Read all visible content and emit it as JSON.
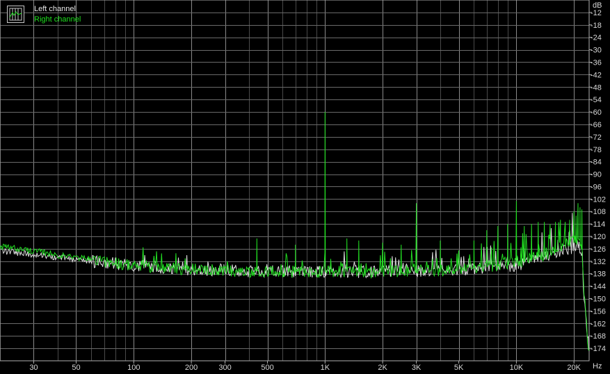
{
  "chart_data": {
    "type": "line",
    "title": "",
    "xlabel": "Hz",
    "ylabel": "dB",
    "x_scale": "log",
    "xlim": [
      20,
      24000
    ],
    "ylim": [
      -180,
      -6
    ],
    "grid": true,
    "legend_position": "top-left",
    "x_tick_labels": [
      "30",
      "50",
      "100",
      "200",
      "300",
      "500",
      "1K",
      "2K",
      "3K",
      "5K",
      "10K",
      "20K"
    ],
    "y_tick_labels": [
      "-12",
      "-18",
      "-24",
      "-30",
      "-36",
      "-42",
      "-48",
      "-54",
      "-60",
      "-66",
      "-72",
      "-78",
      "-84",
      "-90",
      "-96",
      "-102",
      "-108",
      "-114",
      "-120",
      "-126",
      "-132",
      "-138",
      "-144",
      "-150",
      "-156",
      "-162",
      "-168",
      "-174"
    ],
    "series": [
      {
        "name": "Left channel",
        "color": "#e0e0e0",
        "noise_floor": [
          [
            20,
            -127
          ],
          [
            25,
            -128
          ],
          [
            30,
            -129
          ],
          [
            40,
            -130
          ],
          [
            60,
            -132
          ],
          [
            100,
            -134
          ],
          [
            200,
            -136
          ],
          [
            500,
            -137
          ],
          [
            1000,
            -137
          ],
          [
            2000,
            -137
          ],
          [
            5000,
            -136
          ],
          [
            10000,
            -134
          ],
          [
            16000,
            -129
          ],
          [
            20000,
            -125
          ],
          [
            21000,
            -124
          ],
          [
            22000,
            -130
          ],
          [
            23000,
            -160
          ],
          [
            24000,
            -178
          ]
        ],
        "peaks": [
          [
            1000,
            -132
          ],
          [
            3000,
            -134
          ],
          [
            10000,
            -130
          ]
        ]
      },
      {
        "name": "Right channel",
        "color": "#22e022",
        "noise_floor": [
          [
            20,
            -125
          ],
          [
            25,
            -126
          ],
          [
            30,
            -127
          ],
          [
            40,
            -129
          ],
          [
            60,
            -131
          ],
          [
            100,
            -134
          ],
          [
            200,
            -136
          ],
          [
            500,
            -137
          ],
          [
            1000,
            -137
          ],
          [
            2000,
            -137
          ],
          [
            5000,
            -136
          ],
          [
            10000,
            -133
          ],
          [
            16000,
            -127
          ],
          [
            20000,
            -122
          ],
          [
            21000,
            -121
          ],
          [
            22000,
            -128
          ],
          [
            23000,
            -158
          ],
          [
            24000,
            -178
          ]
        ],
        "peaks": [
          [
            440,
            -121
          ],
          [
            700,
            -124
          ],
          [
            1000,
            -60
          ],
          [
            1300,
            -121
          ],
          [
            1500,
            -122
          ],
          [
            2000,
            -123
          ],
          [
            2500,
            -124
          ],
          [
            3000,
            -104
          ],
          [
            4000,
            -122
          ],
          [
            6000,
            -122
          ],
          [
            7000,
            -117
          ],
          [
            8000,
            -115
          ],
          [
            9000,
            -114
          ],
          [
            10000,
            -103
          ],
          [
            11000,
            -115
          ],
          [
            12000,
            -114
          ],
          [
            13000,
            -113
          ],
          [
            14000,
            -113
          ],
          [
            15000,
            -114
          ],
          [
            16000,
            -113
          ],
          [
            17000,
            -112
          ],
          [
            18000,
            -113
          ],
          [
            19000,
            -112
          ],
          [
            20000,
            -108
          ],
          [
            20500,
            -110
          ],
          [
            21000,
            -104
          ],
          [
            21500,
            -106
          ],
          [
            22000,
            -107
          ]
        ]
      }
    ]
  }
}
